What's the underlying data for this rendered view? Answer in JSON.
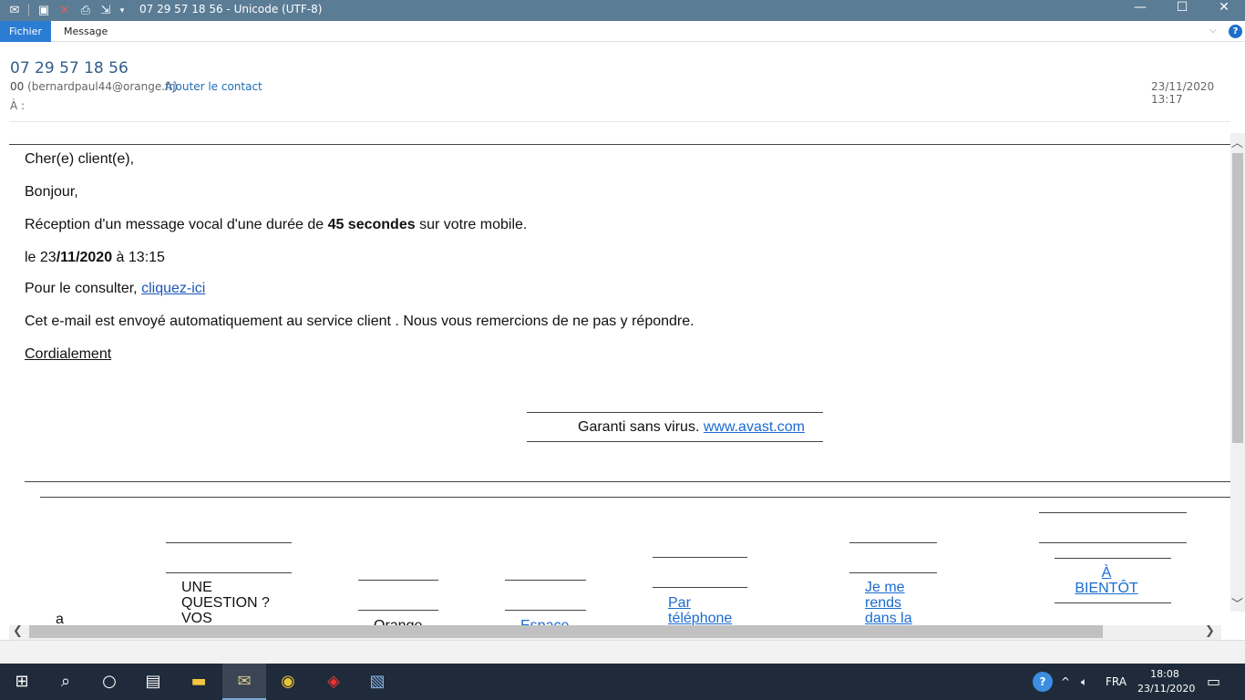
{
  "window": {
    "title": "07 29 57 18 56 - Unicode (UTF-8)",
    "minimize_glyph": "—",
    "maximize_glyph": "☐",
    "close_glyph": "✕"
  },
  "quick_access": {
    "icons": [
      "envelope-icon",
      "save-icon",
      "delete-icon",
      "print-icon",
      "move-icon",
      "dropdown-icon"
    ]
  },
  "ribbon": {
    "file_tab": "Fichier",
    "message_tab": "Message",
    "collapse_glyph": "⌵",
    "help_glyph": "?"
  },
  "header": {
    "subject": "07 29 57 18 56",
    "sender_name": "00",
    "sender_email": "(bernardpaul44@orange.fr)",
    "add_contact": "Ajouter le contact",
    "date": "23/11/2020 13:17",
    "to_label": "À :"
  },
  "body": {
    "greeting": "Cher(e) client(e),",
    "hello": "Bonjour,",
    "line1_before": "Réception d'un message vocal d'une durée de ",
    "line1_bold": "45 secondes",
    "line1_after": " sur votre mobile.",
    "line2_before": "le 23",
    "line2_bold": "/11/2020",
    "line2_after": " à 13:15",
    "line3_before": "Pour le consulter, ",
    "line3_link": "cliquez-ici",
    "line4": "Cet e-mail est envoyé automatiquement au service client . Nous vous remercions de ne pas y répondre.",
    "closing": "Cordialement",
    "virus_text": "Garanti sans virus. ",
    "virus_link": "www.avast.com"
  },
  "footer_table": {
    "col1": "a",
    "col2": "UNE QUESTION ? VOS",
    "col3": "Orange",
    "col4": "Espace",
    "col5": "Par téléphone",
    "col6": "Je me rends dans la",
    "col7": "À BIENTÔT"
  },
  "taskbar": {
    "icons": [
      "windows-icon",
      "search-icon",
      "cortana-icon",
      "task-view-icon",
      "file-explorer-icon",
      "mail-icon",
      "chrome-icon",
      "acrobat-icon",
      "photos-icon"
    ],
    "tray_lang": "FRA",
    "tray_time": "18:08",
    "tray_date": "23/11/2020"
  }
}
